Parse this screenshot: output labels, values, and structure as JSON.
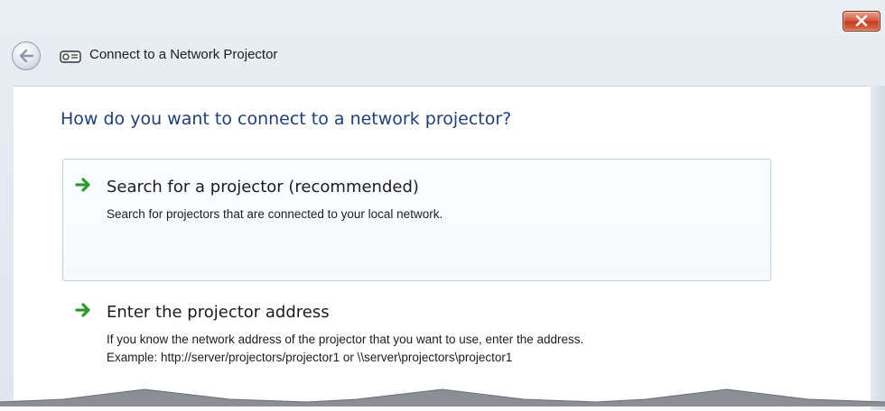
{
  "window": {
    "title": "Connect to a Network Projector"
  },
  "question": "How do you want to connect to a network projector?",
  "options": [
    {
      "title": "Search for a projector (recommended)",
      "description": "Search for projectors that are connected to your local network."
    },
    {
      "title": "Enter the projector address",
      "description_line1": "If you know the network address of the projector that you want to use, enter the address.",
      "description_line2": "Example: http://server/projectors/projector1 or \\\\server\\projectors\\projector1"
    }
  ],
  "icons": {
    "back": "back-arrow-icon",
    "close": "close-icon",
    "app": "projector-icon",
    "option_arrow": "green-arrow-icon"
  },
  "colors": {
    "heading": "#1e3f7a",
    "arrow": "#2e9a2e",
    "close_button": "#c23a1f",
    "option_border": "#b9d4e8"
  }
}
